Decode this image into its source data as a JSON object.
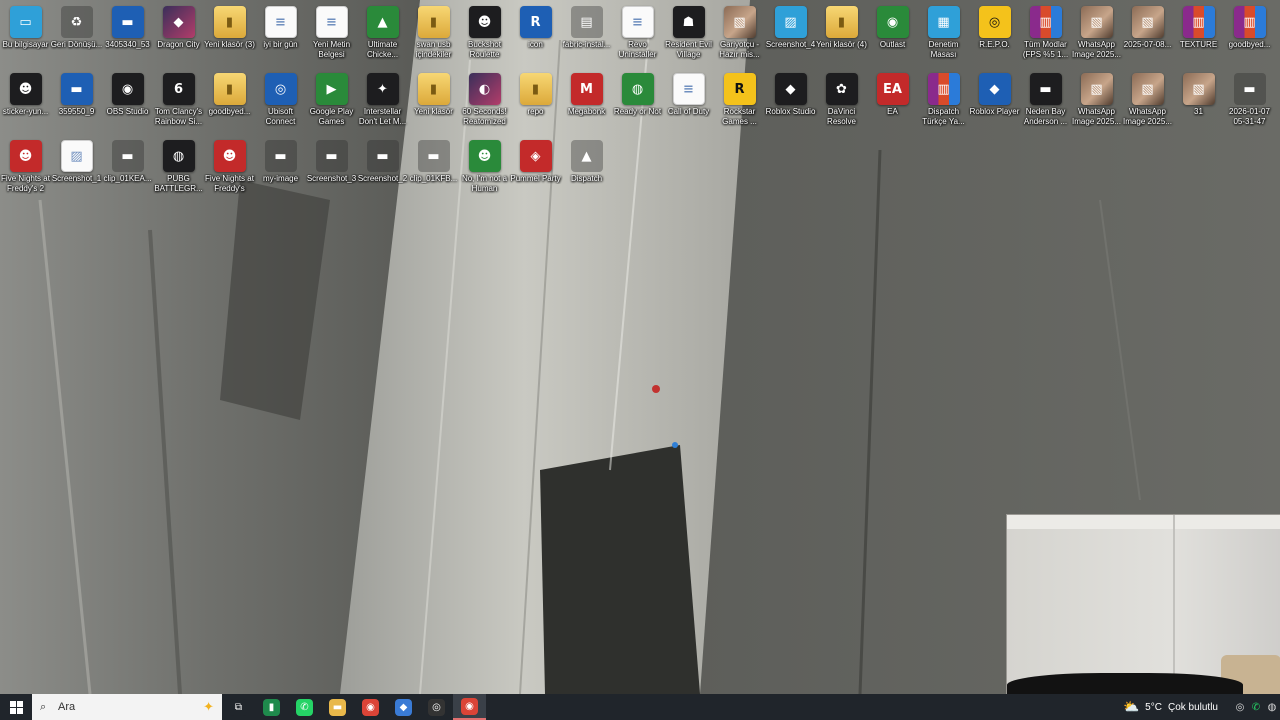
{
  "desktop": {
    "icons": [
      {
        "label": "Bu bilgisayar",
        "glyph": "▭",
        "icon": "this-pc-icon",
        "tile": "t-cyan"
      },
      {
        "label": "Geri Dönüşü...",
        "glyph": "♻",
        "icon": "recycle-bin-icon",
        "tile": "t-ghost"
      },
      {
        "label": "3405340_53",
        "glyph": "▬",
        "icon": "image-file-icon",
        "tile": "t-blue"
      },
      {
        "label": "Dragon City",
        "glyph": "◆",
        "icon": "dragon-city-icon",
        "tile": "t-game"
      },
      {
        "label": "Yeni klasör (3)",
        "glyph": "▮",
        "icon": "folder-icon",
        "tile": "t-folder"
      },
      {
        "label": "iyi bir gün",
        "glyph": "≡",
        "icon": "document-icon",
        "tile": "t-doc"
      },
      {
        "label": "Yeni Metin Belgesi",
        "glyph": "≡",
        "icon": "text-document-icon",
        "tile": "t-doc"
      },
      {
        "label": "Ultimate Chicke...",
        "glyph": "▲",
        "icon": "ultimate-chicken-horse-icon",
        "tile": "t-green"
      },
      {
        "label": "swan usb içindekiler",
        "glyph": "▮",
        "icon": "folder-icon",
        "tile": "t-folder"
      },
      {
        "label": "Buckshot Roulette",
        "glyph": "☻",
        "icon": "buckshot-roulette-icon",
        "tile": "t-dark"
      },
      {
        "label": "icon",
        "glyph": "R",
        "icon": "r-app-icon",
        "tile": "t-blue"
      },
      {
        "label": "fabric-instal...",
        "glyph": "▤",
        "icon": "fabric-installer-icon",
        "tile": "t-ghost"
      },
      {
        "label": "Revo Uninstaller",
        "glyph": "≡",
        "icon": "document-icon",
        "tile": "t-doc"
      },
      {
        "label": "Resident Evil Village",
        "glyph": "☗",
        "icon": "resident-evil-icon",
        "tile": "t-dark"
      },
      {
        "label": "Gariyotçu - Hazır mis...",
        "glyph": "▧",
        "icon": "image-file-icon",
        "tile": "t-photo"
      },
      {
        "label": "Screenshot_4",
        "glyph": "▨",
        "icon": "screenshot-icon",
        "tile": "t-cyan"
      },
      {
        "label": "Yeni klasör (4)",
        "glyph": "▮",
        "icon": "folder-icon",
        "tile": "t-folder"
      },
      {
        "label": "Outlast",
        "glyph": "◉",
        "icon": "outlast-icon",
        "tile": "t-green"
      },
      {
        "label": "Denetim Masası",
        "glyph": "▦",
        "icon": "control-panel-icon",
        "tile": "t-cyan"
      },
      {
        "label": "R.E.P.O.",
        "glyph": "◎",
        "icon": "repo-game-icon",
        "tile": "t-yellow"
      },
      {
        "label": "Tüm Modlar (FPS %5 1...",
        "glyph": "▥",
        "icon": "winrar-archive-icon",
        "tile": "t-rar"
      },
      {
        "label": "WhatsApp Image 2025...",
        "glyph": "▧",
        "icon": "image-file-icon",
        "tile": "t-photo"
      },
      {
        "label": "2025-07-08...",
        "glyph": "▧",
        "icon": "image-file-icon",
        "tile": "t-photo"
      },
      {
        "label": "TEXTURE",
        "glyph": "▥",
        "icon": "winrar-archive-icon",
        "tile": "t-rar"
      },
      {
        "label": "goodbyed...",
        "glyph": "▥",
        "icon": "winrar-archive-icon",
        "tile": "t-rar"
      },
      {
        "label": "sticker-yun...",
        "glyph": "☻",
        "icon": "image-file-icon",
        "tile": "t-dark"
      },
      {
        "label": "359550_9",
        "glyph": "▬",
        "icon": "image-file-icon",
        "tile": "t-blue"
      },
      {
        "label": "OBS Studio",
        "glyph": "◉",
        "icon": "obs-studio-icon",
        "tile": "t-dark"
      },
      {
        "label": "Tom Clancy's Rainbow Si...",
        "glyph": "6",
        "icon": "rainbow-six-icon",
        "tile": "t-dark"
      },
      {
        "label": "goodbyed...",
        "glyph": "▮",
        "icon": "folder-icon",
        "tile": "t-folder"
      },
      {
        "label": "Ubisoft Connect",
        "glyph": "◎",
        "icon": "ubisoft-connect-icon",
        "tile": "t-blue"
      },
      {
        "label": "Google Play Games",
        "glyph": "▶",
        "icon": "google-play-games-icon",
        "tile": "t-green"
      },
      {
        "label": "Interstellar Don't Let M...",
        "glyph": "✦",
        "icon": "interstellar-icon",
        "tile": "t-dark"
      },
      {
        "label": "Yeni klasör",
        "glyph": "▮",
        "icon": "folder-icon",
        "tile": "t-folder"
      },
      {
        "label": "60 Seconds! Reatomized",
        "glyph": "◐",
        "icon": "sixty-seconds-icon",
        "tile": "t-game"
      },
      {
        "label": "repo",
        "glyph": "▮",
        "icon": "folder-icon",
        "tile": "t-folder"
      },
      {
        "label": "Megabonk",
        "glyph": "M",
        "icon": "megabonk-icon",
        "tile": "t-red"
      },
      {
        "label": "Ready or Not",
        "glyph": "◍",
        "icon": "ready-or-not-icon",
        "tile": "t-green"
      },
      {
        "label": "Call of Duty",
        "glyph": "≡",
        "icon": "document-icon",
        "tile": "t-doc"
      },
      {
        "label": "Rockstar Games ...",
        "glyph": "R",
        "icon": "rockstar-games-icon",
        "tile": "t-yellow"
      },
      {
        "label": "Roblox Studio",
        "glyph": "◆",
        "icon": "roblox-studio-icon",
        "tile": "t-dark"
      },
      {
        "label": "DaVinci Resolve",
        "glyph": "✿",
        "icon": "davinci-resolve-icon",
        "tile": "t-dark"
      },
      {
        "label": "EA",
        "glyph": "EA",
        "icon": "ea-app-icon",
        "tile": "t-red"
      },
      {
        "label": "Dispatch Türkçe Ya...",
        "glyph": "▥",
        "icon": "winrar-archive-icon",
        "tile": "t-rar"
      },
      {
        "label": "Roblox Player",
        "glyph": "◆",
        "icon": "roblox-player-icon",
        "tile": "t-blue"
      },
      {
        "label": "Neden Bay Anderson ...",
        "glyph": "▬",
        "icon": "video-file-icon",
        "tile": "t-dark"
      },
      {
        "label": "WhatsApp Image 2025...",
        "glyph": "▧",
        "icon": "image-file-icon",
        "tile": "t-photo"
      },
      {
        "label": "WhatsApp Image 2025...",
        "glyph": "▧",
        "icon": "image-file-icon",
        "tile": "t-photo"
      },
      {
        "label": "31",
        "glyph": "▧",
        "icon": "image-file-icon",
        "tile": "t-photo"
      },
      {
        "label": "2026-01-07 05-31-47",
        "glyph": "▬",
        "icon": "video-file-icon",
        "tile": "t-ghost"
      },
      {
        "label": "Five Nights at Freddy's 2",
        "glyph": "☻",
        "icon": "fnaf2-icon",
        "tile": "t-red"
      },
      {
        "label": "Screenshot_1",
        "glyph": "▨",
        "icon": "screenshot-icon",
        "tile": "t-doc"
      },
      {
        "label": "clip_01KEA...",
        "glyph": "▬",
        "icon": "video-file-icon",
        "tile": "t-ghost"
      },
      {
        "label": "PUBG BATTLEGR...",
        "glyph": "◍",
        "icon": "pubg-icon",
        "tile": "t-dark"
      },
      {
        "label": "Five Nights at Freddy's",
        "glyph": "☻",
        "icon": "fnaf-icon",
        "tile": "t-red"
      },
      {
        "label": "my-image",
        "glyph": "▬",
        "icon": "image-file-icon",
        "tile": "t-ghost"
      },
      {
        "label": "Screenshot_3",
        "glyph": "▬",
        "icon": "screenshot-icon",
        "tile": "t-ghost"
      },
      {
        "label": "Screenshot_2",
        "glyph": "▬",
        "icon": "screenshot-icon",
        "tile": "t-ghost"
      },
      {
        "label": "clip_01KFB...",
        "glyph": "▬",
        "icon": "video-file-icon",
        "tile": "t-ghost"
      },
      {
        "label": "No, I'm not a Human",
        "glyph": "☻",
        "icon": "not-a-human-icon",
        "tile": "t-green"
      },
      {
        "label": "Pummel Party",
        "glyph": "◈",
        "icon": "pummel-party-icon",
        "tile": "t-red"
      },
      {
        "label": "Dispatch",
        "glyph": "▲",
        "icon": "dispatch-icon",
        "tile": "t-ghost"
      }
    ]
  },
  "taskbar": {
    "search_placeholder": "Ara",
    "apps": [
      {
        "name": "task-view-button",
        "glyph": "⧉",
        "color": "#20252b"
      },
      {
        "name": "file-app-button",
        "glyph": "▮",
        "color": "#1f8a4c"
      },
      {
        "name": "whatsapp-button",
        "glyph": "✆",
        "color": "#25d366"
      },
      {
        "name": "file-explorer-button",
        "glyph": "▬",
        "color": "#e8b84a"
      },
      {
        "name": "chrome-button",
        "glyph": "◉",
        "color": "#db4437"
      },
      {
        "name": "vpn-app-button",
        "glyph": "◆",
        "color": "#3a7bd5"
      },
      {
        "name": "obs-button",
        "glyph": "◎",
        "color": "#333333"
      },
      {
        "name": "chrome-active-button",
        "glyph": "◉",
        "color": "#db4437"
      }
    ],
    "weather": {
      "temperature": "5°C",
      "condition": "Çok bulutlu"
    }
  },
  "colors": {
    "taskbar_bg": "#20252b",
    "label_text": "#ffffff"
  }
}
